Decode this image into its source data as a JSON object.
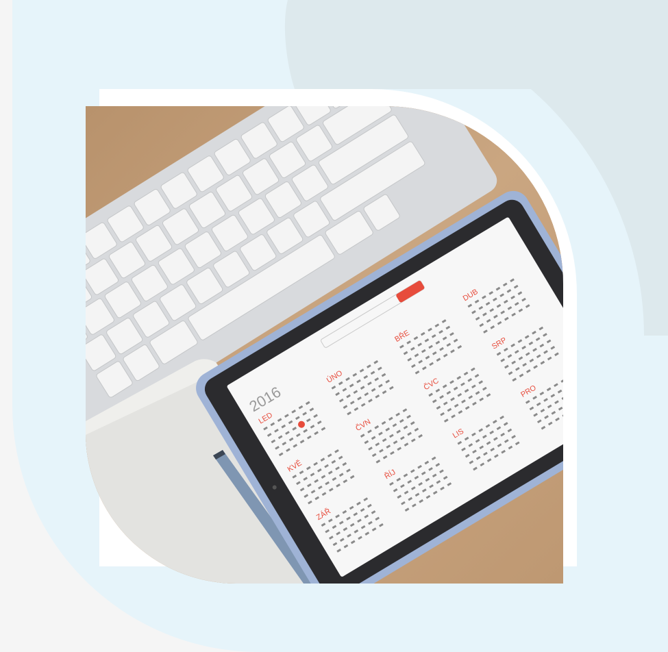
{
  "scene": {
    "subject": "",
    "colors": {
      "background": "#f5f5f5",
      "panel": "#e6f4fa",
      "accent_panel": "#dde9ed",
      "desk": "#c8a27c",
      "tablet_frame": "#9fb3d6",
      "screen": "#f7f7f7",
      "highlight": "#e74c3c"
    }
  },
  "calendar": {
    "year": "2016",
    "months": [
      "LED",
      "ÚNO",
      "BŘE",
      "DUB",
      "KVĚ",
      "ČVN",
      "ČVC",
      "SRP",
      "ZÁŘ",
      "ŘÍJ",
      "LIS",
      "PRO"
    ]
  }
}
